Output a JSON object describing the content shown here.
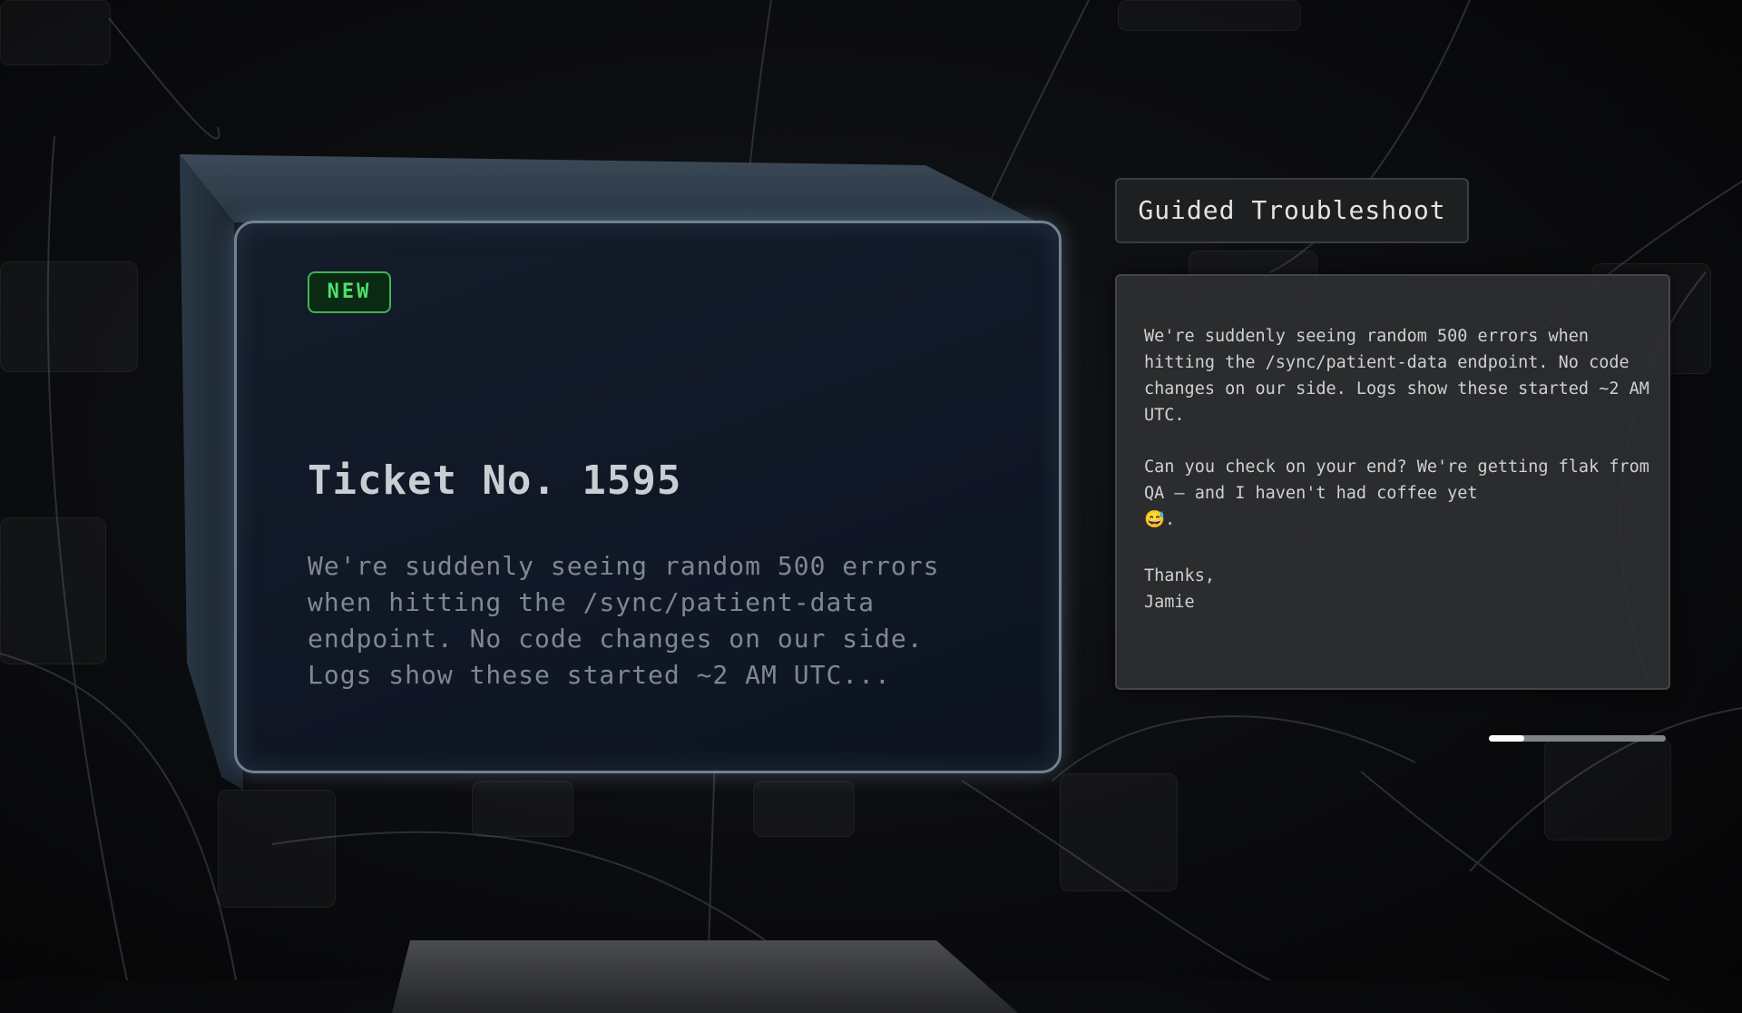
{
  "ticket": {
    "badge": "NEW",
    "title": "Ticket No. 1595",
    "preview": "We're suddenly seeing random 500 errors when hitting the /sync/patient-data endpoint. No code changes on our side. Logs show these started ~2 AM UTC..."
  },
  "panel": {
    "title": "Guided Troubleshoot",
    "message_paragraph_1": "We're suddenly seeing random 500 errors when hitting the /sync/patient-data endpoint. No code changes on our side. Logs show these started ~2 AM UTC.",
    "message_paragraph_2": "Can you check on your end? We're getting flak from QA — and I haven't had coffee yet",
    "message_emoji": "😅",
    "message_emoji_suffix": ".",
    "signoff": "Thanks,",
    "signature": "Jamie"
  },
  "progress": {
    "value": 0.2
  },
  "colors": {
    "badge_green": "#4ee06a",
    "card_border": "#6f8394",
    "panel_bg": "#2e2f31"
  }
}
